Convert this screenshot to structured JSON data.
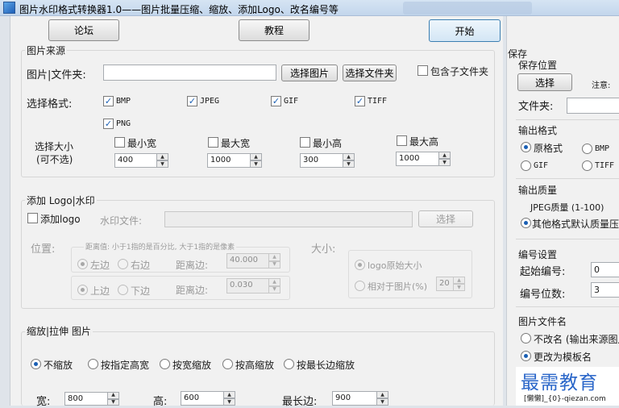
{
  "window": {
    "title": "图片水印格式转换器1.0——图片批量压缩、缩放、添加Logo、改名编号等"
  },
  "toolbar": {
    "forum_label": "论坛",
    "tutorial_label": "教程",
    "start_label": "开始"
  },
  "source": {
    "group_title": "图片来源",
    "path_label": "图片|文件夹:",
    "path_value": "",
    "select_image_label": "选择图片",
    "select_folder_label": "选择文件夹",
    "include_sub_label": "包含子文件夹",
    "include_sub_checked": false,
    "format_label": "选择格式:",
    "formats": [
      {
        "label": "BMP",
        "checked": true
      },
      {
        "label": "JPEG",
        "checked": true
      },
      {
        "label": "GIF",
        "checked": true
      },
      {
        "label": "TIFF",
        "checked": true
      },
      {
        "label": "PNG",
        "checked": true
      }
    ],
    "size_label_line1": "选择大小",
    "size_label_line2": "(可不选)",
    "size_filters": [
      {
        "label": "最小宽",
        "checked": false,
        "value": "400"
      },
      {
        "label": "最大宽",
        "checked": false,
        "value": "1000"
      },
      {
        "label": "最小高",
        "checked": false,
        "value": "300"
      },
      {
        "label": "最大高",
        "checked": false,
        "value": "1000"
      }
    ]
  },
  "logo": {
    "group_title": "添加 Logo|水印",
    "add_logo_label": "添加logo",
    "add_logo_checked": false,
    "watermark_file_label": "水印文件:",
    "watermark_file_value": "",
    "select_label": "选择",
    "position_label": "位置:",
    "distance_hint": "距离值: 小于1指的是百分比, 大于1指的是像素",
    "left_label": "左边",
    "right_label": "右边",
    "top_label": "上边",
    "bottom_label": "下边",
    "distance_label": "距离边:",
    "distance_h_value": "40.000",
    "distance_v_value": "0.030",
    "size_label": "大小:",
    "logo_original_label": "logo原始大小",
    "relative_label": "相对于图片(%)",
    "relative_value": "20"
  },
  "scale": {
    "group_title": "缩放|拉伸 图片",
    "options": [
      {
        "label": "不缩放",
        "selected": true
      },
      {
        "label": "按指定高宽",
        "selected": false
      },
      {
        "label": "按宽缩放",
        "selected": false
      },
      {
        "label": "按高缩放",
        "selected": false
      },
      {
        "label": "按最长边缩放",
        "selected": false
      }
    ],
    "width_label": "宽:",
    "width_value": "800",
    "height_label": "高:",
    "height_value": "600",
    "longest_label": "最长边:",
    "longest_value": "900"
  },
  "save": {
    "title": "保存",
    "location_title": "保存位置",
    "select_label": "选择",
    "note_label": "注意:",
    "folder_label": "文件夹:",
    "folder_value": ""
  },
  "output_format": {
    "title": "输出格式",
    "options": [
      {
        "label": "原格式",
        "selected": true
      },
      {
        "label": "BMP",
        "selected": false
      },
      {
        "label": "GIF",
        "selected": false
      },
      {
        "label": "TIFF",
        "selected": false
      }
    ]
  },
  "output_quality": {
    "title": "输出质量",
    "jpeg_label": "JPEG质量 (1-100)",
    "other_label": "其他格式默认质量压缩"
  },
  "numbering": {
    "title": "编号设置",
    "start_label": "起始编号:",
    "start_value": "0",
    "digits_label": "编号位数:",
    "digits_value": "3"
  },
  "filename": {
    "title": "图片文件名",
    "no_rename_label": "不改名 (输出来源图片",
    "template_label": "更改为模板名",
    "template_value": "[懒懒]_{0}-qiezan.com"
  },
  "watermark_overlay": {
    "main": "最需教育",
    "sub": "[懒懒]_{0}-qiezan.com"
  },
  "colors": {
    "accent": "#1a5fb4",
    "panel": "#f1f1f1",
    "window_bg": "#dfe4ea",
    "title_bar": "#c3d6ec",
    "watermark_text": "#2a66c9"
  }
}
